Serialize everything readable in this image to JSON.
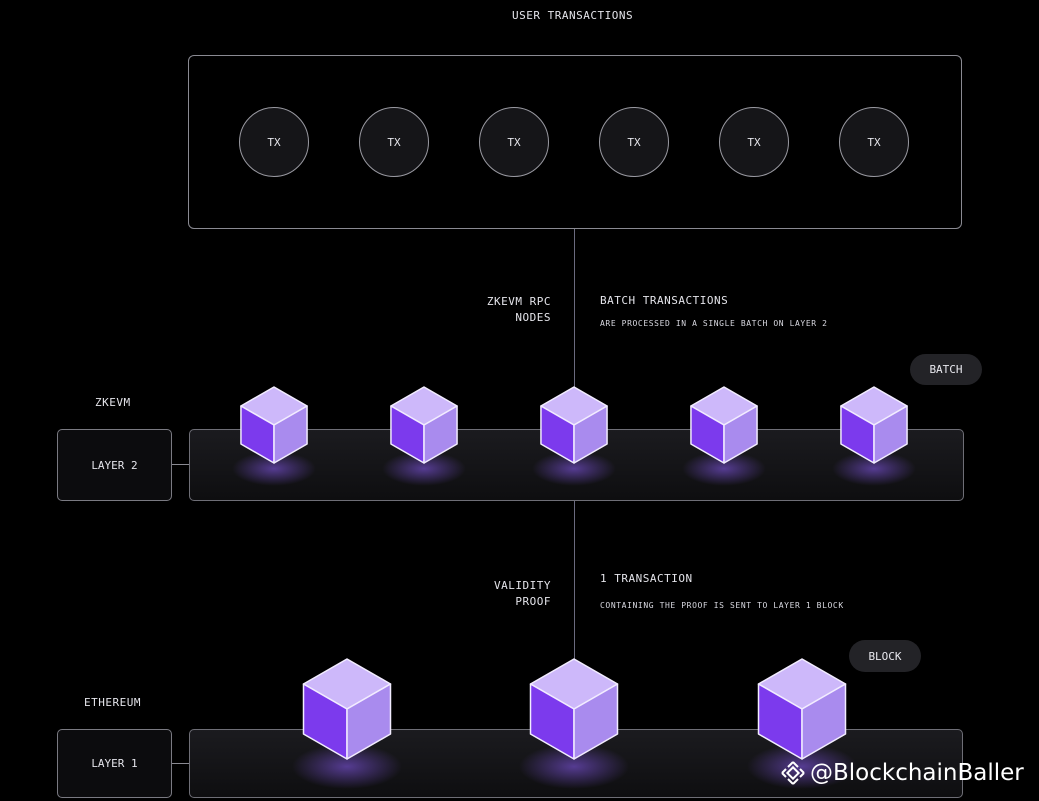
{
  "header": {
    "title": "USER TRANSACTIONS"
  },
  "transactions": [
    "TX",
    "TX",
    "TX",
    "TX",
    "TX",
    "TX"
  ],
  "layer2": {
    "side_label": "ZKEVM",
    "box_label": "LAYER 2",
    "rpc_label_1": "ZKEVM RPC",
    "rpc_label_2": "NODES",
    "batch_title": "BATCH TRANSACTIONS",
    "batch_desc": "ARE PROCESSED IN A SINGLE BATCH ON LAYER 2",
    "pill": "BATCH"
  },
  "layer1": {
    "side_label": "ETHEREUM",
    "box_label": "LAYER 1",
    "proof_label_1": "VALIDITY",
    "proof_label_2": "PROOF",
    "tx_title": "1 TRANSACTION",
    "tx_desc": "CONTAINING THE PROOF IS SENT TO LAYER 1 BLOCK",
    "pill": "BLOCK"
  },
  "watermark": {
    "text": "@BlockchainBaller"
  },
  "colors": {
    "background": "#000000",
    "cube_top": "#cdb8fa",
    "cube_left": "#7c3aed",
    "cube_right": "#a98bee",
    "cube_edge": "#f2ecff",
    "cube_glow": "#8b5cf6"
  }
}
